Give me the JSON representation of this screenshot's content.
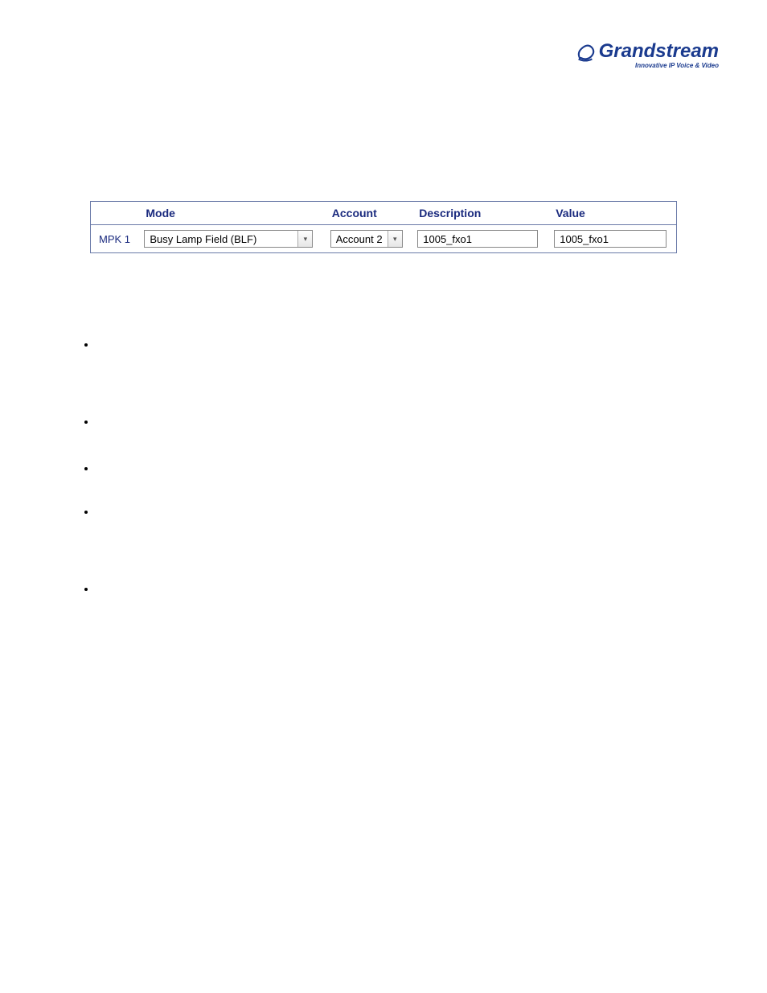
{
  "logo": {
    "brand": "Grandstream",
    "tagline": "Innovative IP Voice & Video"
  },
  "table": {
    "headers": {
      "col1": "",
      "mode": "Mode",
      "account": "Account",
      "description": "Description",
      "value": "Value"
    },
    "rows": [
      {
        "label": "MPK 1",
        "mode": "Busy Lamp Field (BLF)",
        "account": "Account 2",
        "description": "1005_fxo1",
        "value": "1005_fxo1"
      }
    ]
  }
}
